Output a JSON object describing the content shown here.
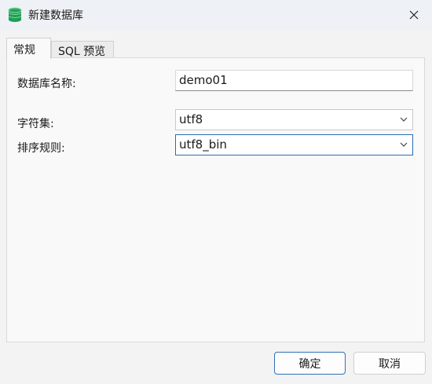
{
  "window": {
    "title": "新建数据库",
    "icon": "database-icon",
    "close_icon": "close-icon"
  },
  "tabs": [
    {
      "label": "常规",
      "active": true
    },
    {
      "label": "SQL 预览",
      "active": false
    }
  ],
  "form": {
    "db_name_label": "数据库名称:",
    "db_name_value": "demo01",
    "charset_label": "字符集:",
    "charset_value": "utf8",
    "collation_label": "排序规则:",
    "collation_value": "utf8_bin"
  },
  "buttons": {
    "ok": "确定",
    "cancel": "取消"
  },
  "colors": {
    "accent": "#2f6fb6",
    "icon_green": "#1f9d55"
  }
}
